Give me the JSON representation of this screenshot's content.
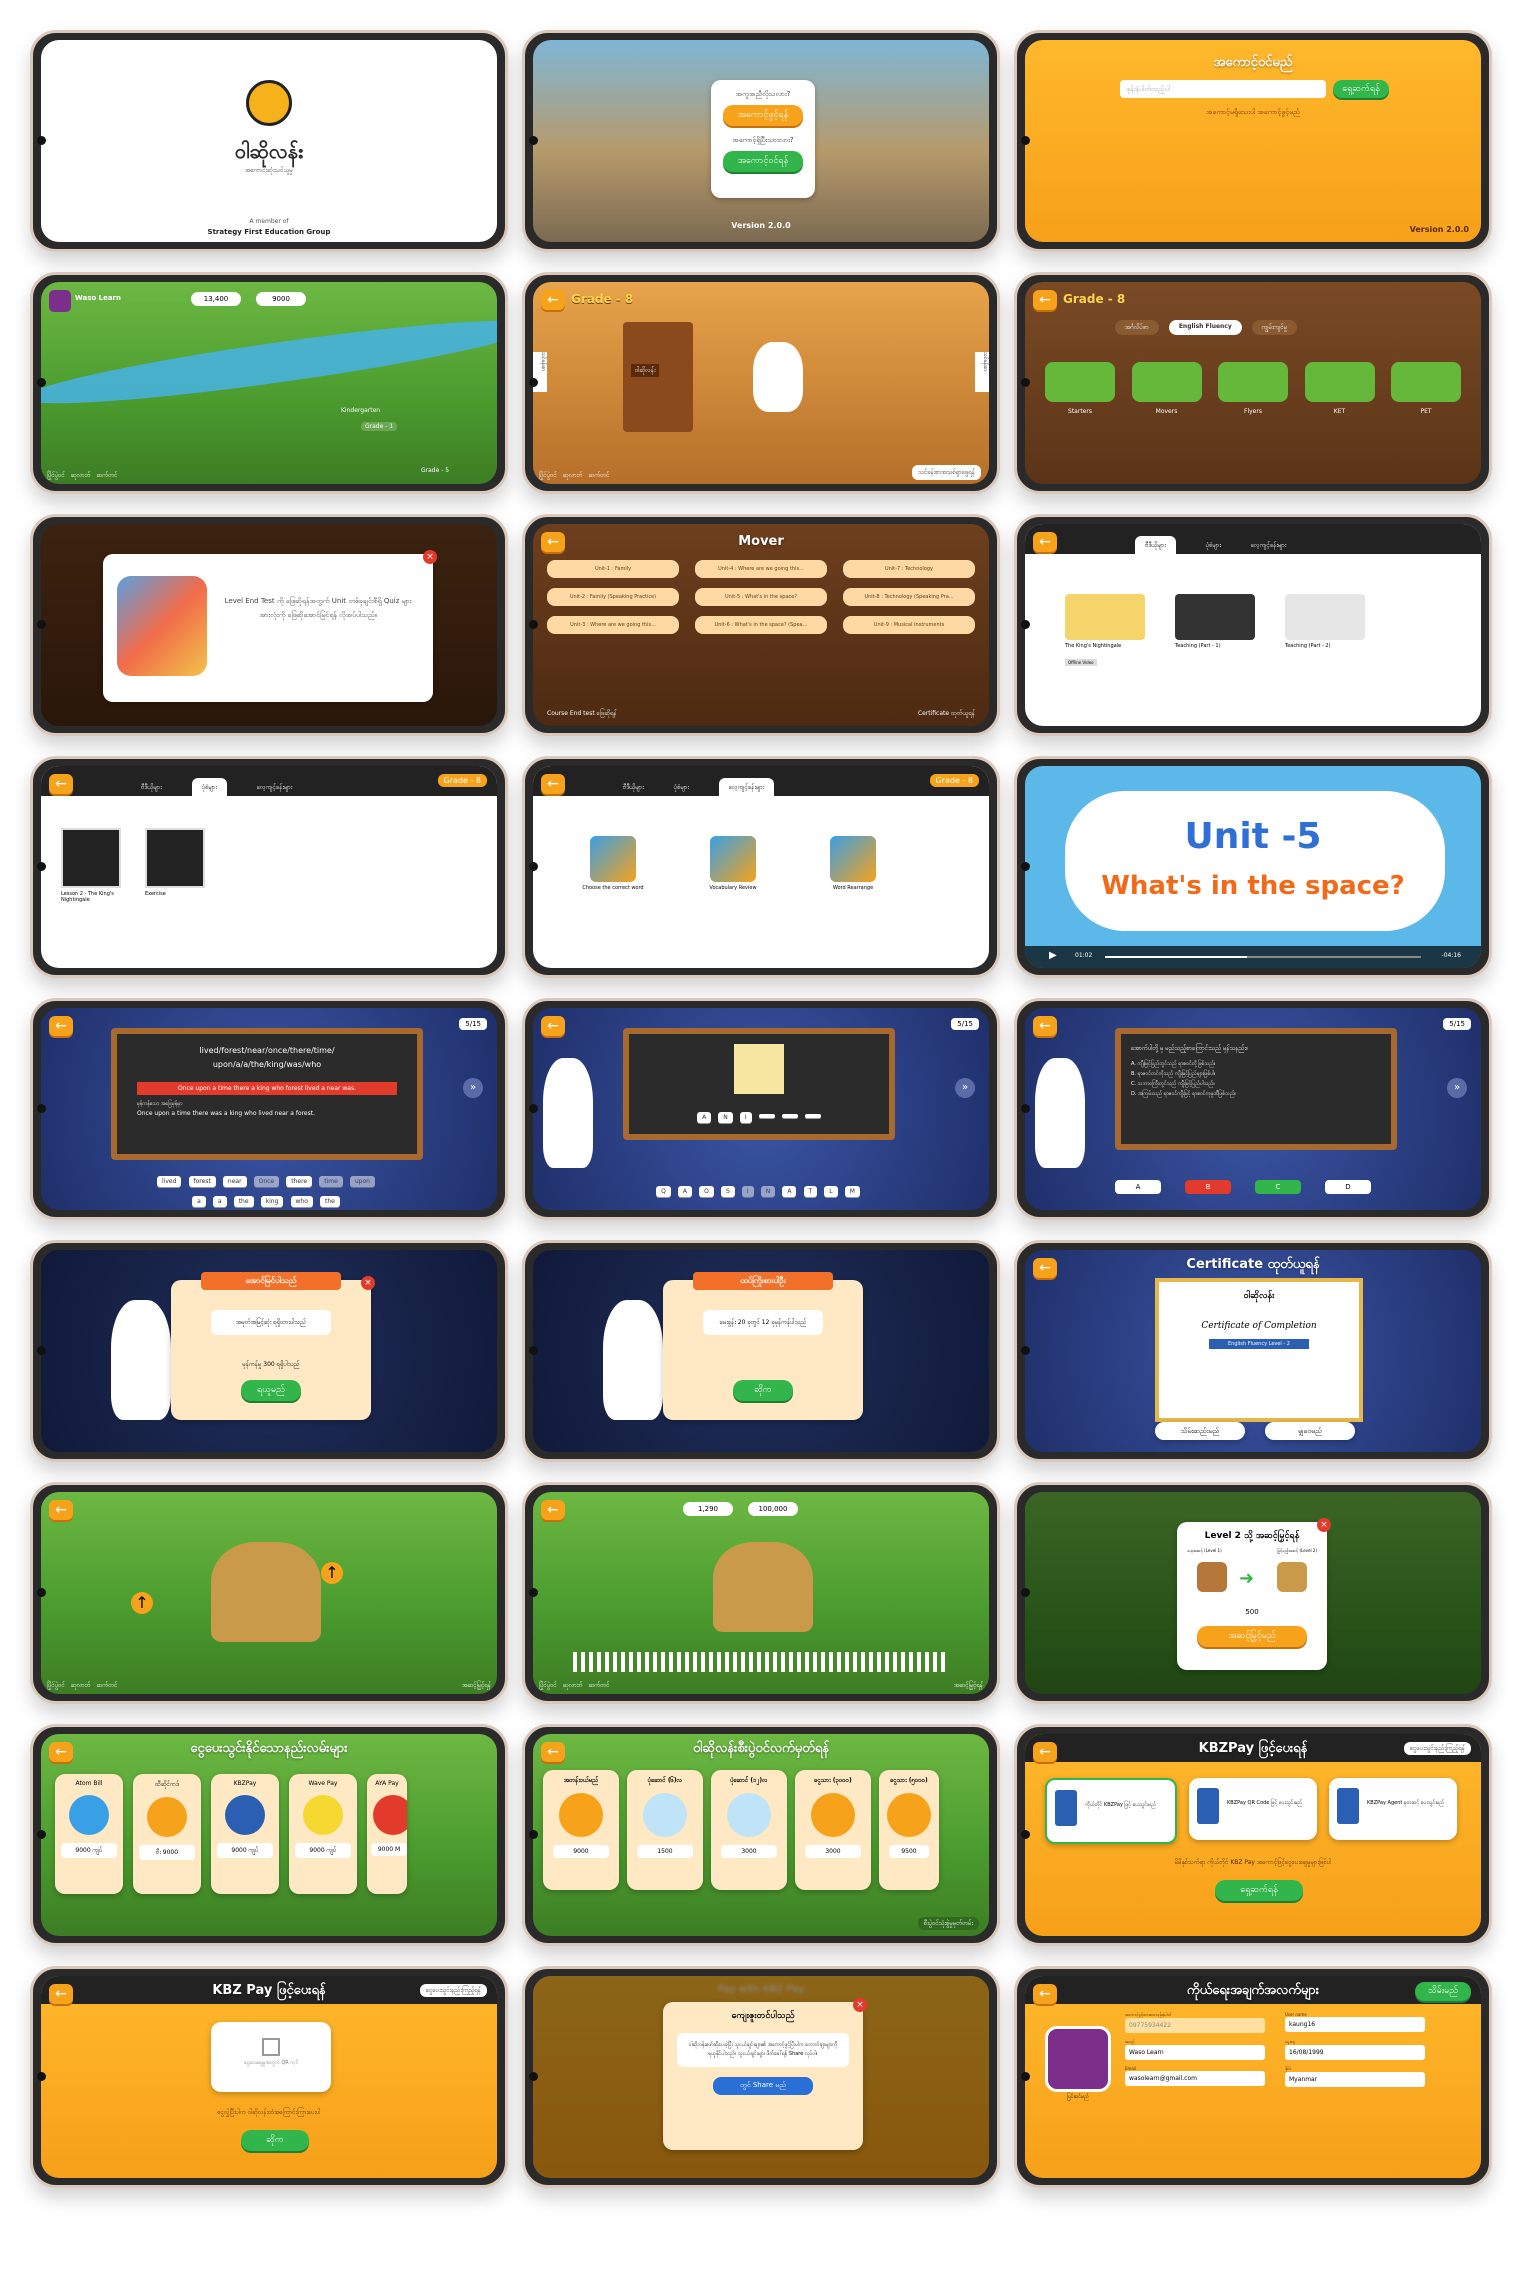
{
  "s1": {
    "logo_text": "ဝါဆိုလန်း",
    "tagline": "အကောင်းဆုံးသင်ယူမှု",
    "member": "A member of",
    "group": "Strategy First Education Group"
  },
  "s2": {
    "q1": "အကူအညီလိုသလား?",
    "b1": "အကောင့်ဖွင့်ရန်",
    "q2": "အကောင့်ရှိပြီးသားလား?",
    "b2": "အကောင့်ဝင်ရန်",
    "version": "Version 2.0.0"
  },
  "s3": {
    "title": "အကောင့်ဝင်မည်",
    "placeholder": "ဖုန်းနံပါတ်ထည့်ပါ",
    "button": "ရှေ့ဆက်ရန်",
    "link": "အကောင့်မရှိသေးပါ အကောင့်ဖွင့်မည်",
    "version": "Version 2.0.0"
  },
  "s4": {
    "user": "Waso Learn",
    "coins": "13,400",
    "gems": "9000",
    "labels": [
      "ဂုဏ်ရည်",
      "အင်္ဂလိပ်",
      "ဂုဏ်ရည်",
      "Kindergarten",
      "Grade - 1",
      "Grade - 2",
      "Grade - 3",
      "Grade - 4",
      "Grade - 5"
    ],
    "bottom": [
      "ပြိုင်ပွဲဝင်",
      "ဆုလာဘ်",
      "ဆက်တင်"
    ]
  },
  "s5": {
    "grade": "Grade - 8",
    "left_tab": "သင်ခန်းစာ",
    "right_tab": "သင်ခန်းစာ",
    "sign": "ဝါဆိုလန်း",
    "bottom": [
      "ပြိုင်ပွဲဝင်",
      "ဆုလာဘ်",
      "ဆက်တင်"
    ],
    "cta": "သင်ခန်းစာအသစ်ရှာဖွေရန်"
  },
  "s6": {
    "grade": "Grade - 8",
    "tabs": [
      "အင်္ဂလိပ်စာ",
      "English Fluency",
      "ကျွမ်းကျင်မှု"
    ],
    "levels": [
      "Starters",
      "Movers",
      "Flyers",
      "KET",
      "PET"
    ]
  },
  "s7": {
    "message": "Level End Test ကို ဖြေဆိုရန်အတွက် Unit တစ်ခုချင်းစီရှိ Quiz များအားလုံးကို ဖြေဆိုအောင်မြင်ရန် လိုအပ်ပါသည်။"
  },
  "s8": {
    "title": "Mover",
    "units": [
      "Unit-1 : Family",
      "Unit-4 : Where are we going this...",
      "Unit-7 : Technology",
      "Unit-2 : Family (Speaking Practice)",
      "Unit-5 : What's in the space?",
      "Unit-8 : Technology (Speaking Pra...",
      "Unit-3 : Where are we going this...",
      "Unit-6 : What's in the space? (Spea...",
      "Unit-9 : Musical Instruments"
    ],
    "left_foot": "Course End test ဖြေဆိုရန်",
    "right_foot": "Certificate ထုတ်ယူရန်"
  },
  "s9": {
    "tabs": [
      "ဗီဒီယိုများ",
      "ပုံစံများ",
      "လေ့ကျင့်ခန်းများ"
    ],
    "videos": [
      {
        "title": "The King's Nightingale",
        "tag": "Offline Video"
      },
      {
        "title": "Teaching (Part - 1)",
        "tag": ""
      },
      {
        "title": "Teaching (Part - 2)",
        "tag": ""
      }
    ]
  },
  "s10": {
    "tabs": [
      "ဗီဒီယိုများ",
      "ပုံစံများ",
      "လေ့ကျင့်ခန်းများ"
    ],
    "grade": "Grade - 8",
    "items": [
      "Lesson 2 - The King's Nightingale",
      "Exercise"
    ]
  },
  "s11": {
    "tabs": [
      "ဗီဒီယိုများ",
      "ပုံစံများ",
      "လေ့ကျင့်ခန်းများ"
    ],
    "grade": "Grade - 8",
    "items": [
      "Choose the correct word",
      "Vocabulary Review",
      "Word Rearrange"
    ]
  },
  "s12": {
    "line1": "Unit -5",
    "line2": "What's in the space?",
    "time_start": "01:02",
    "time_end": "-04:16"
  },
  "s13": {
    "counter": "5/15",
    "prompt": "lived/forest/near/once/there/time/ upon/a/a/the/king/was/who",
    "answer": "Once upon a time there a king who forest lived a near was.",
    "correct_label": "မှန်ကန်သော အဖြေမှန်မှာ",
    "correct": "Once upon a time there was a king who lived near a forest.",
    "words": [
      "lived",
      "forest",
      "near",
      "Once",
      "there",
      "time",
      "upon",
      "a",
      "a",
      "the",
      "king",
      "who",
      "the"
    ]
  },
  "s14": {
    "counter": "5/15",
    "slots": [
      "A",
      "N",
      "I",
      "",
      "",
      ""
    ],
    "letters": [
      "Q",
      "A",
      "O",
      "S",
      "I",
      "N",
      "A",
      "T",
      "L",
      "M"
    ]
  },
  "s15": {
    "counter": "5/15",
    "question": "အောက်ပါတို့ မှ မည်သည့်စာကြောင်းသည် မှန်သနည်း။",
    "options": [
      "A. ကျီးမြင့်ပြည်တွင်သည် ရာဇဝင်တို့ဖြစ်သည်။",
      "B. ရာဇဝင်တင်ကိုသည် ကျီးမြင့်ပြည်များဖြစ်ပါ။",
      "C. သဘာဝကြီးတွင်သည် ကျီးမြင့်ပြည်ပါသည်။",
      "D. အကြမ်းသည် ရာဇဝင်ကျီးမြင့် ရာဇဝင်ကုမ္ပဏီဖြစ်သည်။"
    ],
    "buttons": [
      "A",
      "B",
      "C",
      "D"
    ]
  },
  "s16": {
    "ribbon": "အောင်မြင်ပါသည်",
    "body": "အမှတ်အမြင့်ဆုံး ရရှိထားပါသည်",
    "score": "မှန်ကန်မှု 300 ရရှိပါသည်",
    "button": "ရယူမည်",
    "counter": "5/15"
  },
  "s17": {
    "ribbon": "ထပ်ကြိုးစားပါဦး",
    "body": "မေးခွန်း 20 ခုတွင် 12 ခုမှန်ကန်ပါသည်",
    "button": "ဆိုက",
    "counter": "5/15"
  },
  "s18": {
    "title": "Certificate ထုတ်ယူရန်",
    "brand": "ဝါဆိုလန်း",
    "cert": "Certificate of Completion",
    "course": "English Fluency Level - 2",
    "download": "သိမ်းဆည်းမည်",
    "share": "မျှဝေမည်"
  },
  "s19": {
    "bottom": [
      "ပြိုင်ပွဲဝင်",
      "ဆုလာဘ်",
      "ဆက်တင်"
    ],
    "right": "အဆင့်မြှင့်ရန်"
  },
  "s20": {
    "coins": "1,290",
    "gems": "100,000",
    "bottom": [
      "ပြိုင်ပွဲဝင်",
      "ဆုလာဘ်",
      "ဆက်တင်"
    ],
    "right": "အဆင့်မြှင့်ရန်"
  },
  "s21": {
    "title": "Level 2 သို့ အဆင့်မြှင့်ရန်",
    "from": "ယခုအဆင့် (Level 1)",
    "to": "မြှင့်မည့်အဆင့် (Level 2)",
    "cost": "500",
    "button": "အဆင့်မြှင့်မည်"
  },
  "s22": {
    "title": "ငွေပေးသွင်းနိုင်သောနည်းလမ်းများ",
    "methods": [
      {
        "name": "Atom Bill",
        "price": "9000 ကျပ်"
      },
      {
        "name": "ထီဆိုင်ကဒ်",
        "price": "ဗီး 9000"
      },
      {
        "name": "KBZPay",
        "price": "9000 ကျပ်"
      },
      {
        "name": "Wave Pay",
        "price": "9000 ကျပ်"
      },
      {
        "name": "AYA Pay",
        "price": "9000 M"
      }
    ]
  },
  "s23": {
    "title": "ဝါဆိုလန်းစီးပွဲဝင်လက်မှတ်ရန်",
    "plans": [
      {
        "name": "အတန်းဝယ်မည်",
        "price": "9000"
      },
      {
        "name": "ပုံဆောင် (၆)လ",
        "price": "1500"
      },
      {
        "name": "ပုံဆောင် (၁၂)လ",
        "price": "3000"
      },
      {
        "name": "ငွေသား (၃၀၀၀)",
        "price": "3000"
      },
      {
        "name": "ငွေသား (၅၀၀၀)",
        "price": "9500"
      }
    ],
    "footer": "စီးပွဲဝင်သုံးစွဲမှုမှတ်တမ်း"
  },
  "s24": {
    "title": "KBZPay ဖြင့်ပေးရန်",
    "help": "ငွေပေးသွင်းနည်းကြည့်ရန်",
    "options": [
      "ကိုယ်တိုင် KBZPay ဖြင့် ပေးသွင်းမည်",
      "KBZPay QR Code ဖြင့် ပေးသွင်းမည်",
      "KBZPay Agent မှတဆင့် ပေးသွင်းမည်"
    ],
    "note": "မိမိနှစ်သက်ရာ ကိုယ်တိုင် KBZ Pay အကောင့်ဖြင့်ငွေပေးချေမှုများဖြစ်ပါ",
    "button": "ရှေ့ဆက်ရန်"
  },
  "s25": {
    "title": "KBZ Pay ဖြင့်ပေးရန်",
    "help": "ငွေပေးသွင်းနည်းကြည့်ရန်",
    "qr_text": "ငွေပေးချေမှုအတွက် QR ကုဒ်",
    "note": "ငွေလွှဲပြီးပါက ဝါဆိုလန်းထံအကြောင်းကြားပေးပါ",
    "button": "ဆိုက"
  },
  "s26": {
    "ribbon": "ကျေးဇူးတင်ပါသည်",
    "body": "ဝါဆိုလန်းဖော်ဆိုပေးခဲ့ပြီး သူငယ်ချင်းများ၏ အကောင့်ဖွင့်ပြီးပါက ဘောက်ချာများကို ရယူနိုင်ပါသည်။ သူငယ်ချင်းများ ဖိတ်ခေါ်ရန် Share လုပ်ပါ။",
    "button": "တွင် Share မည်",
    "blur_title": "Pay with KBZ Pay"
  },
  "s27": {
    "title": "ကိုယ်ရေးအချက်အလက်များ",
    "save": "သိမ်းမည်",
    "edit": "ပြင်ဆင်မည်",
    "fields": [
      {
        "label": "အကောင့်ဖွင့်ထားသောဖုန်းနံပါတ်",
        "value": "09775934422"
      },
      {
        "label": "User name",
        "value": "kaung16"
      },
      {
        "label": "အမည်",
        "value": "Waso Learn"
      },
      {
        "label": "မွေးနေ့",
        "value": "16/08/1999"
      },
      {
        "label": "Email",
        "value": "wasolearn@gmail.com"
      },
      {
        "label": "နိုင်ငံ",
        "value": "Myanmar"
      }
    ]
  },
  "colors": {
    "orange": "#f7a01a",
    "green": "#32b54a",
    "blue": "#2a3f86",
    "wood": "#6e3f1e",
    "red": "#e23b2c"
  }
}
